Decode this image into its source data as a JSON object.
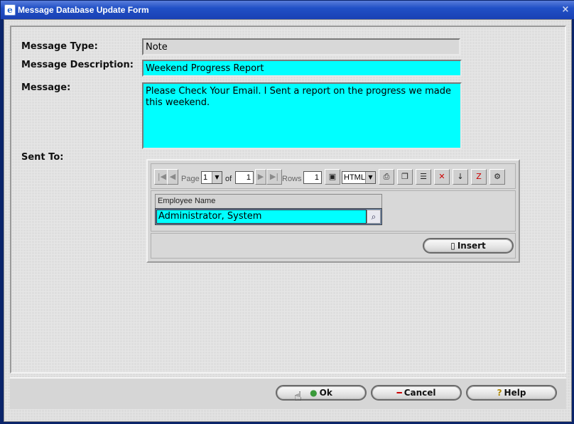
{
  "window": {
    "title": "Message Database Update Form",
    "close_glyph": "×"
  },
  "form": {
    "message_type_label": "Message Type:",
    "message_type_value": "Note",
    "message_description_label": "Message Description:",
    "message_description_value": "Weekend Progress Report",
    "message_label": "Message:",
    "message_value": "Please Check Your Email. I Sent a report on the progress we made this weekend.",
    "sent_to_label": "Sent To:"
  },
  "grid": {
    "page_label": "Page",
    "page_value": "1",
    "of_label": "of",
    "of_value": "1",
    "rows_label": "Rows",
    "rows_value": "1",
    "format_value": "HTML",
    "column_header": "Employee Name",
    "rows": [
      "Administrator, System"
    ],
    "insert_label": "Insert"
  },
  "buttons": {
    "ok_label": "Ok",
    "cancel_label": "Cancel",
    "help_label": "Help"
  },
  "colors": {
    "input_highlight": "#00ffff",
    "titlebar": "#2150c6"
  }
}
